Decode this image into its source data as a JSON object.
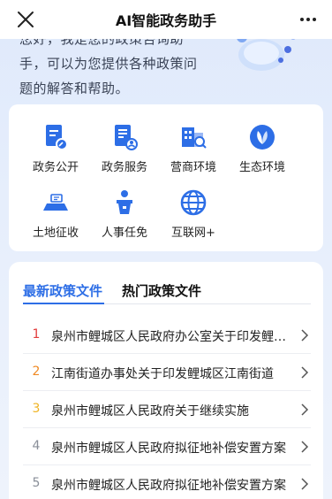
{
  "header": {
    "title": "AI智能政务助手"
  },
  "greeting": {
    "line1": "您好，我是您的政策咨询助",
    "line2": "手，可以为您提供各种政策问",
    "line3": "题的解答和帮助。"
  },
  "services": [
    {
      "label": "政务公开",
      "icon": "document-edit-icon",
      "color": "#2d6ee6"
    },
    {
      "label": "政务服务",
      "icon": "document-user-icon",
      "color": "#2d6ee6"
    },
    {
      "label": "营商环境",
      "icon": "building-search-icon",
      "color": "#2d6ee6"
    },
    {
      "label": "生态环境",
      "icon": "leaf-icon",
      "color": "#2d6ee6"
    },
    {
      "label": "土地征收",
      "icon": "land-icon",
      "color": "#2d6ee6"
    },
    {
      "label": "人事任免",
      "icon": "podium-icon",
      "color": "#2d6ee6"
    },
    {
      "label": "互联网+",
      "icon": "globe-icon",
      "color": "#2d6ee6"
    }
  ],
  "tabs": [
    {
      "label": "最新政策文件",
      "active": true
    },
    {
      "label": "热门政策文件",
      "active": false
    }
  ],
  "policies": [
    {
      "num": "1",
      "title": "泉州市鲤城区人民政府办公室关于印发鲤城区",
      "color": "#e23b3b"
    },
    {
      "num": "2",
      "title": "江南街道办事处关于印发鲤城区江南街道",
      "color": "#f08a24"
    },
    {
      "num": "3",
      "title": "泉州市鲤城区人民政府关于继续实施",
      "color": "#f0b424"
    },
    {
      "num": "4",
      "title": "泉州市鲤城区人民政府拟征地补偿安置方案",
      "color": "#8a8f99"
    },
    {
      "num": "5",
      "title": "泉州市鲤城区人民政府拟征地补偿安置方案",
      "color": "#8a8f99"
    }
  ]
}
